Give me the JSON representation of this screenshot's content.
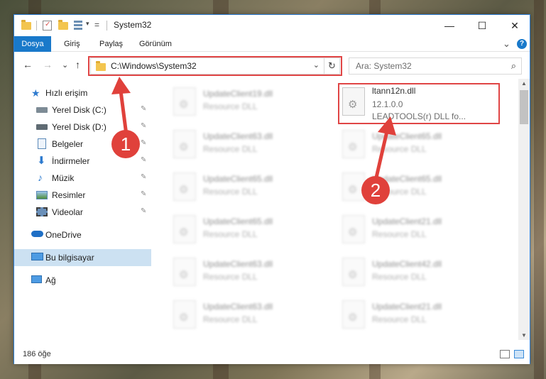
{
  "window": {
    "title": "System32",
    "controls": {
      "minimize": "—",
      "maximize": "☐",
      "close": "✕"
    }
  },
  "ribbon": {
    "tabs": [
      "Dosya",
      "Giriş",
      "Paylaş",
      "Görünüm"
    ],
    "expand": "⌄",
    "help": "?"
  },
  "nav": {
    "back": "←",
    "forward": "→",
    "recent": "⌄",
    "up": "↑",
    "address": "C:\\Windows\\System32",
    "dropdown": "⌄",
    "refresh": "↻",
    "search_placeholder": "Ara: System32",
    "search_icon": "⌕"
  },
  "sidebar": {
    "items": [
      {
        "label": "Hızlı erişim",
        "icon": "star-icon",
        "pinned": false
      },
      {
        "label": "Yerel Disk (C:)",
        "icon": "drive-icon",
        "pinned": true
      },
      {
        "label": "Yerel Disk (D:)",
        "icon": "drive-icon",
        "pinned": true
      },
      {
        "label": "Belgeler",
        "icon": "documents-icon",
        "pinned": true
      },
      {
        "label": "İndirmeler",
        "icon": "download-icon",
        "pinned": true
      },
      {
        "label": "Müzik",
        "icon": "music-icon",
        "pinned": true
      },
      {
        "label": "Resimler",
        "icon": "pictures-icon",
        "pinned": true
      },
      {
        "label": "Videolar",
        "icon": "videos-icon",
        "pinned": true
      },
      {
        "label": "OneDrive",
        "icon": "cloud-icon",
        "pinned": false
      },
      {
        "label": "Bu bilgisayar",
        "icon": "computer-icon",
        "pinned": false
      },
      {
        "label": "Ağ",
        "icon": "network-icon",
        "pinned": false
      }
    ],
    "pin_glyph": "📌"
  },
  "files": {
    "left_column": [
      {
        "name": "UpdateClient19.dll",
        "type": "Resource DLL"
      },
      {
        "name": "UpdateClient63.dll",
        "type": "Resource DLL"
      },
      {
        "name": "UpdateClient65.dll",
        "type": "Resource DLL"
      },
      {
        "name": "UpdateClient65.dll",
        "type": "Resource DLL"
      },
      {
        "name": "UpdateClient63.dll",
        "type": "Resource DLL"
      },
      {
        "name": "UpdateClient63.dll",
        "type": "Resource DLL"
      }
    ],
    "right_column": [
      {
        "name": "UpdateClient65.dll",
        "type": "Resource DLL"
      },
      {
        "name": "UpdateClient65.dll",
        "type": "Resource DLL"
      },
      {
        "name": "UpdateClient21.dll",
        "type": "Resource DLL"
      },
      {
        "name": "UpdateClient42.dll",
        "type": "Resource DLL"
      },
      {
        "name": "UpdateClient21.dll",
        "type": "Resource DLL"
      }
    ],
    "highlighted": {
      "name": "ltann12n.dll",
      "version": "12.1.0.0",
      "description": "LEADTOOLS(r) DLL fo..."
    }
  },
  "status": {
    "item_count": "186 öğe"
  },
  "annotations": {
    "step1": "1",
    "step2": "2",
    "color": "#e0413b"
  }
}
